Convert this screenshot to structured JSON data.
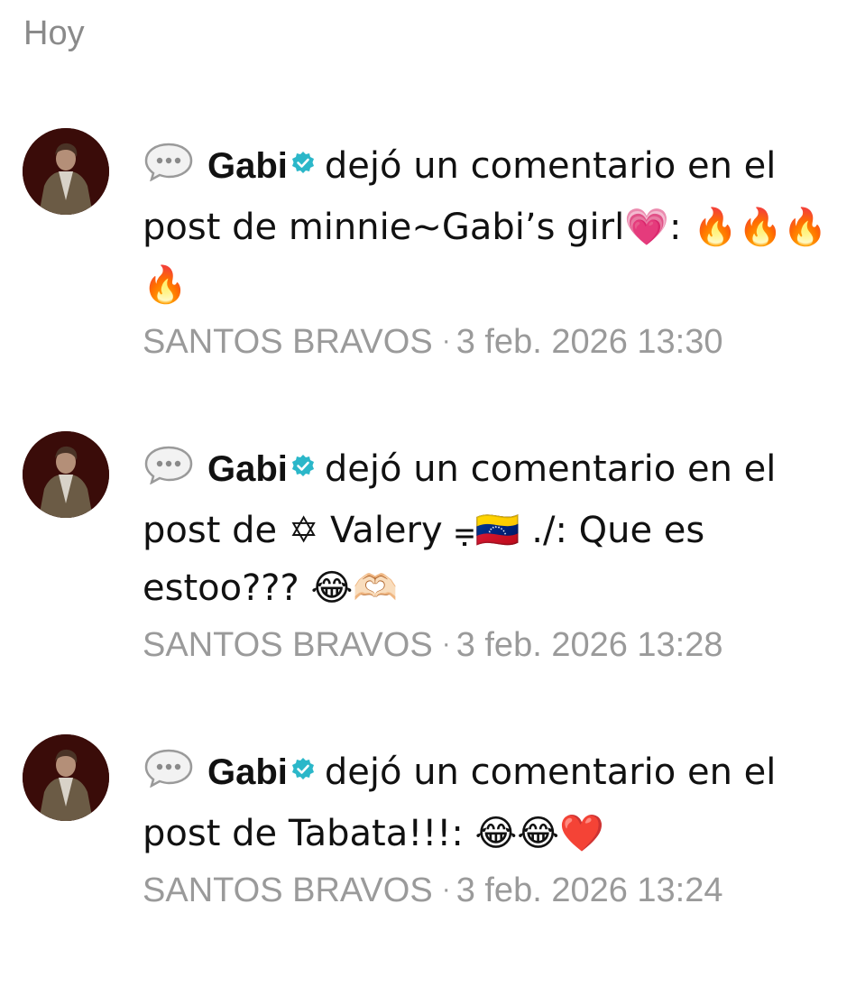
{
  "section": {
    "label": "Hoy"
  },
  "notifications": [
    {
      "author": "Gabi",
      "action": "dejó un comentario en el post de minnie~Gabi’s girl💗: 🔥🔥🔥🔥",
      "source": "SANTOS BRAVOS",
      "separator": "·",
      "timestamp": "3 feb. 2026 13:30"
    },
    {
      "author": "Gabi",
      "action": "dejó un comentario en el post de ✡ Valery ⩦🇻🇪 ./: Que es estoo??? 😂🫶🏻",
      "source": "SANTOS BRAVOS",
      "separator": "·",
      "timestamp": "3 feb. 2026 13:28"
    },
    {
      "author": "Gabi",
      "action": "dejó un comentario en el post de Tabata!!!: 😂😂❤️",
      "source": "SANTOS BRAVOS",
      "separator": "·",
      "timestamp": "3 feb. 2026 13:24"
    }
  ],
  "icons": {
    "comment": "speech-bubble-icon",
    "verified": "verified-badge-icon"
  },
  "colors": {
    "verified_badge": "#2bb7c9",
    "meta_text": "#9a9a9a",
    "section_header": "#8a8a8a"
  }
}
